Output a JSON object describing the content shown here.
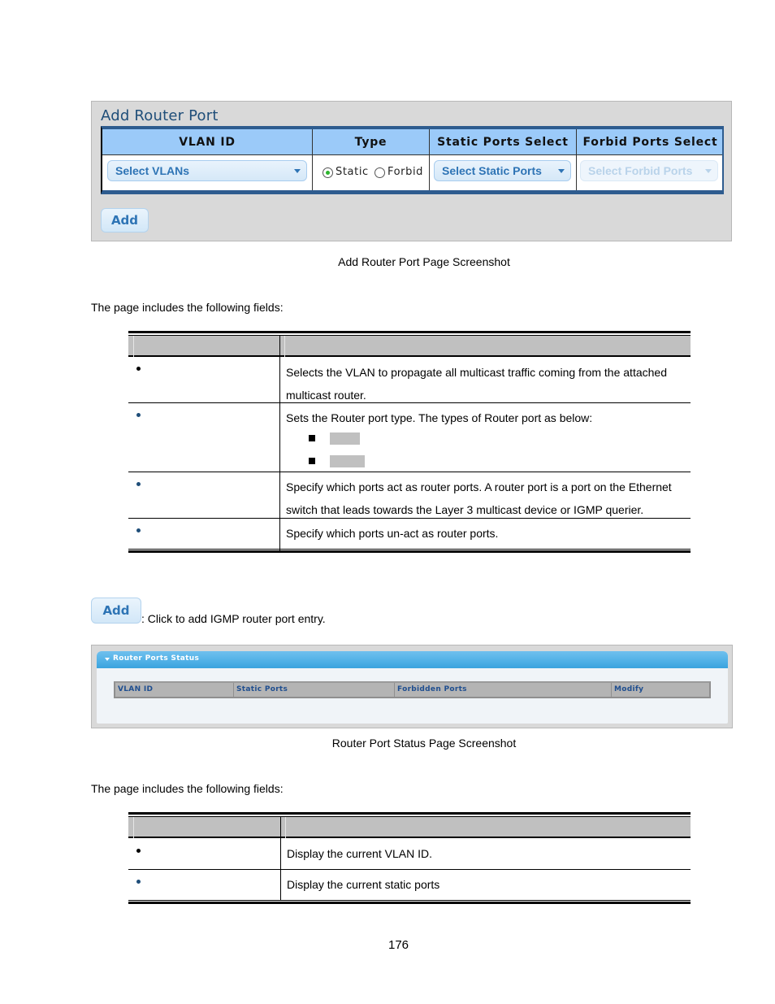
{
  "add_router_port_screenshot": {
    "title": "Add Router Port",
    "columns": [
      "VLAN ID",
      "Type",
      "Static Ports Select",
      "Forbid Ports Select"
    ],
    "vlan_select": {
      "label": "Select VLANs",
      "icon": "chevron-down-icon"
    },
    "type_options": [
      {
        "label": "Static",
        "checked": true
      },
      {
        "label": "Forbid",
        "checked": false
      }
    ],
    "static_ports_select": {
      "label": "Select Static Ports",
      "icon": "chevron-down-icon"
    },
    "forbid_ports_select": {
      "label": "Select Forbid Ports",
      "icon": "chevron-down-icon",
      "disabled": true
    },
    "add_button": "Add",
    "colors": {
      "header_bg": "#9bcaf9",
      "border": "#2e5c8f",
      "select_text": "#2e74b5",
      "radio_checked": "#2db52d"
    }
  },
  "caption1": "Add Router Port Page Screenshot",
  "intro1": "The page includes the following fields:",
  "fields_table1": {
    "rows": [
      {
        "bullet": "bullet-icon",
        "description": "Selects the VLAN to propagate all multicast traffic coming from the attached multicast router."
      },
      {
        "bullet": "bullet-icon",
        "description": "Sets the Router port type. The types of Router port as below:",
        "sub_items": [
          "",
          ""
        ]
      },
      {
        "bullet": "bullet-icon",
        "description": "Specify which ports act as router ports. A router port is a port on the Ethernet switch that leads towards the Layer 3 multicast device or IGMP querier."
      },
      {
        "bullet": "bullet-icon",
        "description": "Specify which ports un-act as router ports."
      }
    ]
  },
  "add_button_doc": {
    "label": "Add",
    "text": ": Click to add IGMP router port entry."
  },
  "router_ports_status_screenshot": {
    "title": "Router Ports Status",
    "collapse_icon": "triangle-down-icon",
    "columns": [
      "VLAN ID",
      "Static Ports",
      "Forbidden Ports",
      "Modify"
    ],
    "colors": {
      "header_bg": "#4fb0e6",
      "column_text": "#1f4e8f"
    }
  },
  "caption2": "Router Port Status Page Screenshot",
  "intro2": "The page includes the following fields:",
  "fields_table2": {
    "rows": [
      {
        "bullet": "bullet-icon",
        "description": "Display the current VLAN ID."
      },
      {
        "bullet": "bullet-icon",
        "description": "Display the current static ports"
      }
    ]
  },
  "page_number": "176"
}
